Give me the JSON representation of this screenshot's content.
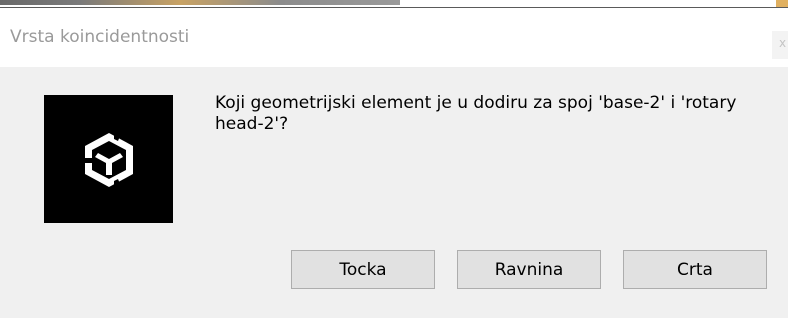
{
  "dialog": {
    "title": "Vrsta koincidentnosti",
    "close_glyph": "x",
    "app_icon": "unity-logo-icon",
    "message": "Koji geometrijski element je u dodiru za spoj 'base-2' i 'rotary head-2'?",
    "buttons": {
      "tocka": "Tocka",
      "ravnina": "Ravnina",
      "crta": "Crta"
    }
  },
  "colors": {
    "dialog_background": "#f0f0f0",
    "titlebar_background": "#ffffff",
    "title_text": "#9a9a9a",
    "button_background": "#e1e1e1",
    "button_border": "#adadad",
    "icon_background": "#000000"
  }
}
